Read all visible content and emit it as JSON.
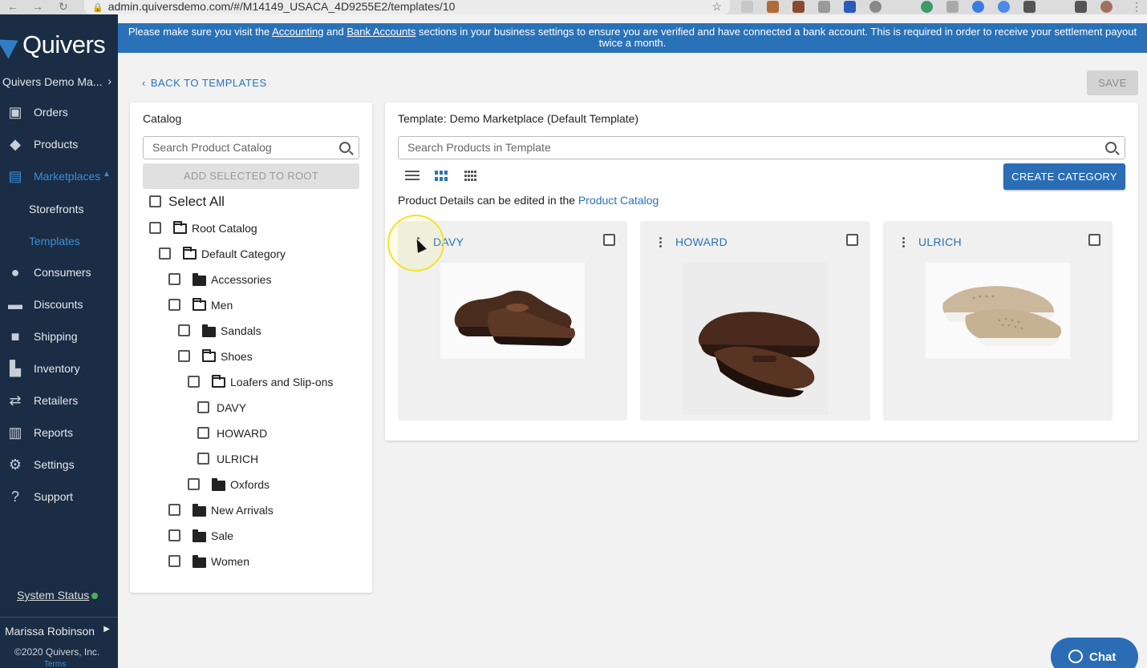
{
  "browser": {
    "url": "admin.quiversdemo.com/#/M14149_USACA_4D9255E2/templates/10"
  },
  "sidebar": {
    "logo": "Quivers",
    "org": "Quivers Demo Ma...",
    "items": [
      {
        "label": "Orders",
        "icon": "box-icon"
      },
      {
        "label": "Products",
        "icon": "tags-icon"
      },
      {
        "label": "Marketplaces",
        "icon": "store-icon"
      },
      {
        "label": "Consumers",
        "icon": "users-icon"
      },
      {
        "label": "Discounts",
        "icon": "money-icon"
      },
      {
        "label": "Shipping",
        "icon": "truck-icon"
      },
      {
        "label": "Inventory",
        "icon": "industry-icon"
      },
      {
        "label": "Retailers",
        "icon": "exchange-icon"
      },
      {
        "label": "Reports",
        "icon": "chart-icon"
      },
      {
        "label": "Settings",
        "icon": "gear-icon"
      },
      {
        "label": "Support",
        "icon": "question-icon"
      }
    ],
    "sub_items": [
      "Storefronts",
      "Templates"
    ],
    "system_status": "System Status",
    "user": "Marissa Robinson",
    "copyright": "©2020 Quivers, Inc.",
    "terms": "Terms"
  },
  "banner": {
    "pre": "Please make sure you visit the ",
    "link1": "Accounting",
    "mid": " and ",
    "link2": "Bank Accounts",
    "post": " sections in your business settings to ensure you are verified and have connected a bank account. This is required in order to receive your settlement payout twice a month."
  },
  "top": {
    "back": "BACK TO TEMPLATES",
    "save": "SAVE"
  },
  "catalog": {
    "title": "Catalog",
    "search_placeholder": "Search Product Catalog",
    "add_root": "ADD SELECTED TO ROOT",
    "select_all": "Select All",
    "tree": [
      {
        "label": "Root Catalog",
        "folder": "open"
      },
      {
        "label": "Default Category",
        "folder": "open"
      },
      {
        "label": "Accessories",
        "folder": "closed"
      },
      {
        "label": "Men",
        "folder": "open"
      },
      {
        "label": "Sandals",
        "folder": "closed"
      },
      {
        "label": "Shoes",
        "folder": "open"
      },
      {
        "label": "Loafers and Slip-ons",
        "folder": "open"
      },
      {
        "label": "DAVY",
        "folder": "none"
      },
      {
        "label": "HOWARD",
        "folder": "none"
      },
      {
        "label": "ULRICH",
        "folder": "none"
      },
      {
        "label": "Oxfords",
        "folder": "closed"
      },
      {
        "label": "New Arrivals",
        "folder": "closed"
      },
      {
        "label": "Sale",
        "folder": "closed"
      },
      {
        "label": "Women",
        "folder": "closed"
      }
    ]
  },
  "template": {
    "title": "Template: Demo Marketplace (Default Template)",
    "search_placeholder": "Search Products in Template",
    "create_category": "CREATE CATEGORY",
    "hint_text": "Product Details can be edited in the ",
    "hint_link": "Product Catalog",
    "products": [
      {
        "name": "DAVY",
        "image": "brown-leather-slip-on-shoe"
      },
      {
        "name": "HOWARD",
        "image": "brown-leather-penny-loafer"
      },
      {
        "name": "ULRICH",
        "image": "tan-perforated-slip-on"
      }
    ]
  },
  "chat": {
    "label": "Chat"
  },
  "colors": {
    "accent": "#2a72b8",
    "sidebar": "#1a2d45",
    "active": "#3b8ed8"
  }
}
